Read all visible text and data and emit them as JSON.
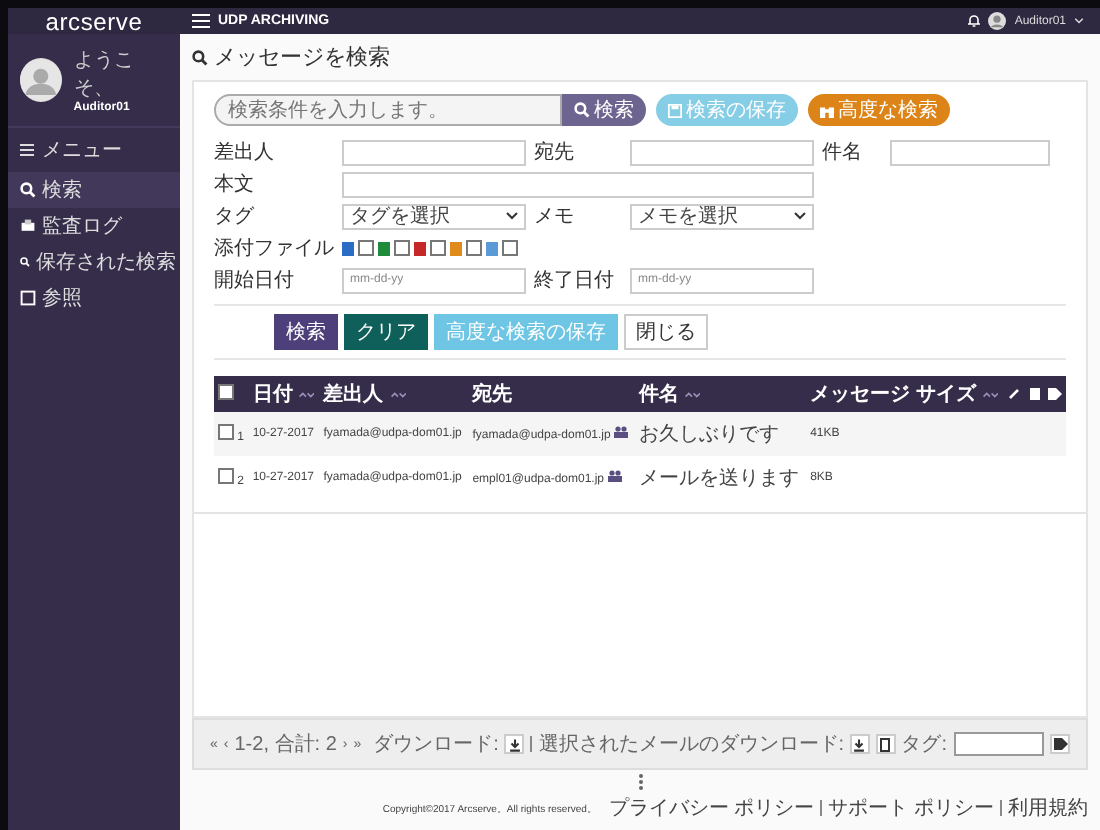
{
  "brand": "arcserve",
  "app_title": "UDP ARCHIVING",
  "user_menu": {
    "name": "Auditor01"
  },
  "sidebar": {
    "greeting": "ようこそ、",
    "user": "Auditor01",
    "menu_label": "メニュー",
    "items": [
      {
        "label": "検索",
        "kind": "search",
        "selected": true
      },
      {
        "label": "監査ログ",
        "kind": "log",
        "selected": false
      },
      {
        "label": "保存された検索",
        "kind": "search",
        "selected": false
      },
      {
        "label": "参照",
        "kind": "browse",
        "selected": false
      }
    ]
  },
  "page_title": "メッセージを検索",
  "search_bar": {
    "placeholder": "検索条件を入力します。",
    "search_button": "検索",
    "save_button": "検索の保存",
    "advanced_button": "高度な検索"
  },
  "form": {
    "sender_label": "差出人",
    "to_label": "宛先",
    "subject_label": "件名",
    "body_label": "本文",
    "tag_label": "タグ",
    "tag_select": "タグを選択",
    "memo_label": "メモ",
    "memo_select": "メモを選択",
    "attachment_label": "添付ファイル",
    "attachment_types": [
      {
        "kind": "word",
        "checked": false
      },
      {
        "kind": "excel",
        "checked": false
      },
      {
        "kind": "pdf",
        "checked": false
      },
      {
        "kind": "image",
        "checked": false
      },
      {
        "kind": "doc",
        "checked": false
      }
    ],
    "start_label": "開始日付",
    "start_placeholder": "mm-dd-yy",
    "end_label": "終了日付",
    "end_placeholder": "mm-dd-yy",
    "buttons": [
      {
        "label": "検索",
        "kind": "primary"
      },
      {
        "label": "クリア",
        "kind": "teal"
      },
      {
        "label": "高度な検索の保存",
        "kind": "info"
      },
      {
        "label": "閉じる",
        "kind": "plain"
      }
    ]
  },
  "table": {
    "select_all_checked": false,
    "columns": [
      {
        "label": "日付",
        "sortable": true
      },
      {
        "label": "差出人",
        "sortable": true
      },
      {
        "label": "宛先",
        "sortable": false
      },
      {
        "label": "件名",
        "sortable": true
      },
      {
        "label": "メッセージ サイズ",
        "sortable": true
      }
    ],
    "rows": [
      {
        "checked": false,
        "index": "1",
        "date": "10-27-2017",
        "from": "fyamada@udpa-dom01.jp",
        "to": "fyamada@udpa-dom01.jp",
        "subject": "お久しぶりです",
        "size": "41KB"
      },
      {
        "checked": false,
        "index": "2",
        "date": "10-27-2017",
        "from": "fyamada@udpa-dom01.jp",
        "to": "empl01@udpa-dom01.jp",
        "subject": "メールを送ります",
        "size": "8KB"
      }
    ]
  },
  "pager": {
    "first": "«",
    "prev": "‹",
    "range": "1-2, 合計: 2",
    "next": "›",
    "last": "»",
    "download_label": "ダウンロード:",
    "selected_download_label": "選択されたメールのダウンロード:",
    "tag_label": "タグ:"
  },
  "footer": {
    "copyright": "Copyright©2017 Arcserve。All rights reserved。",
    "links": [
      "プライバシー ポリシー",
      "サポート ポリシー",
      "利用規約"
    ]
  }
}
